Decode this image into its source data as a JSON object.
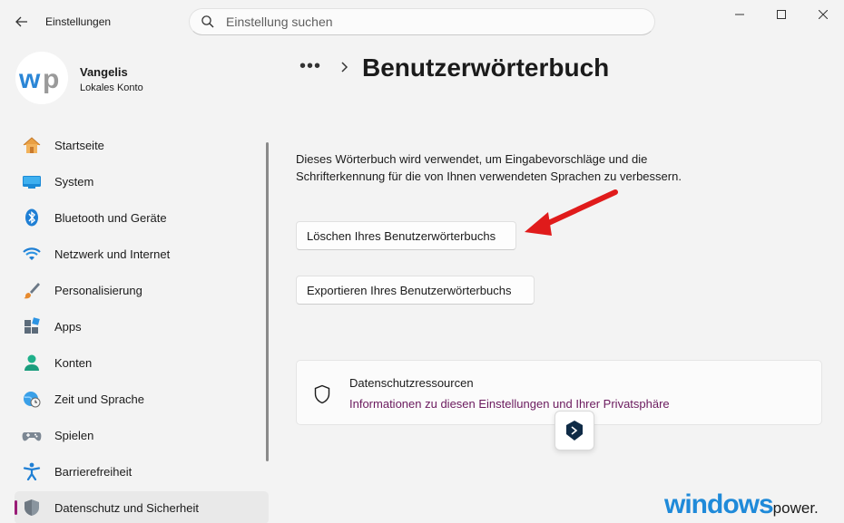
{
  "app": {
    "title": "Einstellungen"
  },
  "search": {
    "placeholder": "Einstellung suchen"
  },
  "profile": {
    "name": "Vangelis",
    "account_type": "Lokales Konto",
    "avatar_text": "wp"
  },
  "sidebar": {
    "items": [
      {
        "label": "Startseite",
        "icon": "home-icon"
      },
      {
        "label": "System",
        "icon": "system-icon"
      },
      {
        "label": "Bluetooth und Geräte",
        "icon": "bluetooth-icon"
      },
      {
        "label": "Netzwerk und Internet",
        "icon": "wifi-icon"
      },
      {
        "label": "Personalisierung",
        "icon": "brush-icon"
      },
      {
        "label": "Apps",
        "icon": "apps-icon"
      },
      {
        "label": "Konten",
        "icon": "person-icon"
      },
      {
        "label": "Zeit und Sprache",
        "icon": "globe-clock-icon"
      },
      {
        "label": "Spielen",
        "icon": "gamepad-icon"
      },
      {
        "label": "Barrierefreiheit",
        "icon": "accessibility-icon"
      },
      {
        "label": "Datenschutz und Sicherheit",
        "icon": "shield-icon",
        "active": true
      }
    ]
  },
  "breadcrumb": {
    "ellipsis": "•••",
    "title": "Benutzerwörterbuch"
  },
  "main": {
    "description": "Dieses Wörterbuch wird verwendet, um Eingabevorschläge und die Schrifterkennung für die von Ihnen verwendeten Sprachen zu verbessern.",
    "clear_button": "Löschen Ihres Benutzerwörterbuchs",
    "export_button": "Exportieren Ihres Benutzerwörterbuchs"
  },
  "privacy": {
    "title": "Datenschutzressourcen",
    "link": "Informationen zu diesen Einstellungen und Ihrer Privatsphäre"
  },
  "watermark": {
    "brand": "windows",
    "suffix": "power."
  },
  "colors": {
    "accent": "#9a1c77",
    "link": "#6b1a5e",
    "annotation_arrow": "#e01b1b",
    "watermark": "#1f8ad9"
  }
}
